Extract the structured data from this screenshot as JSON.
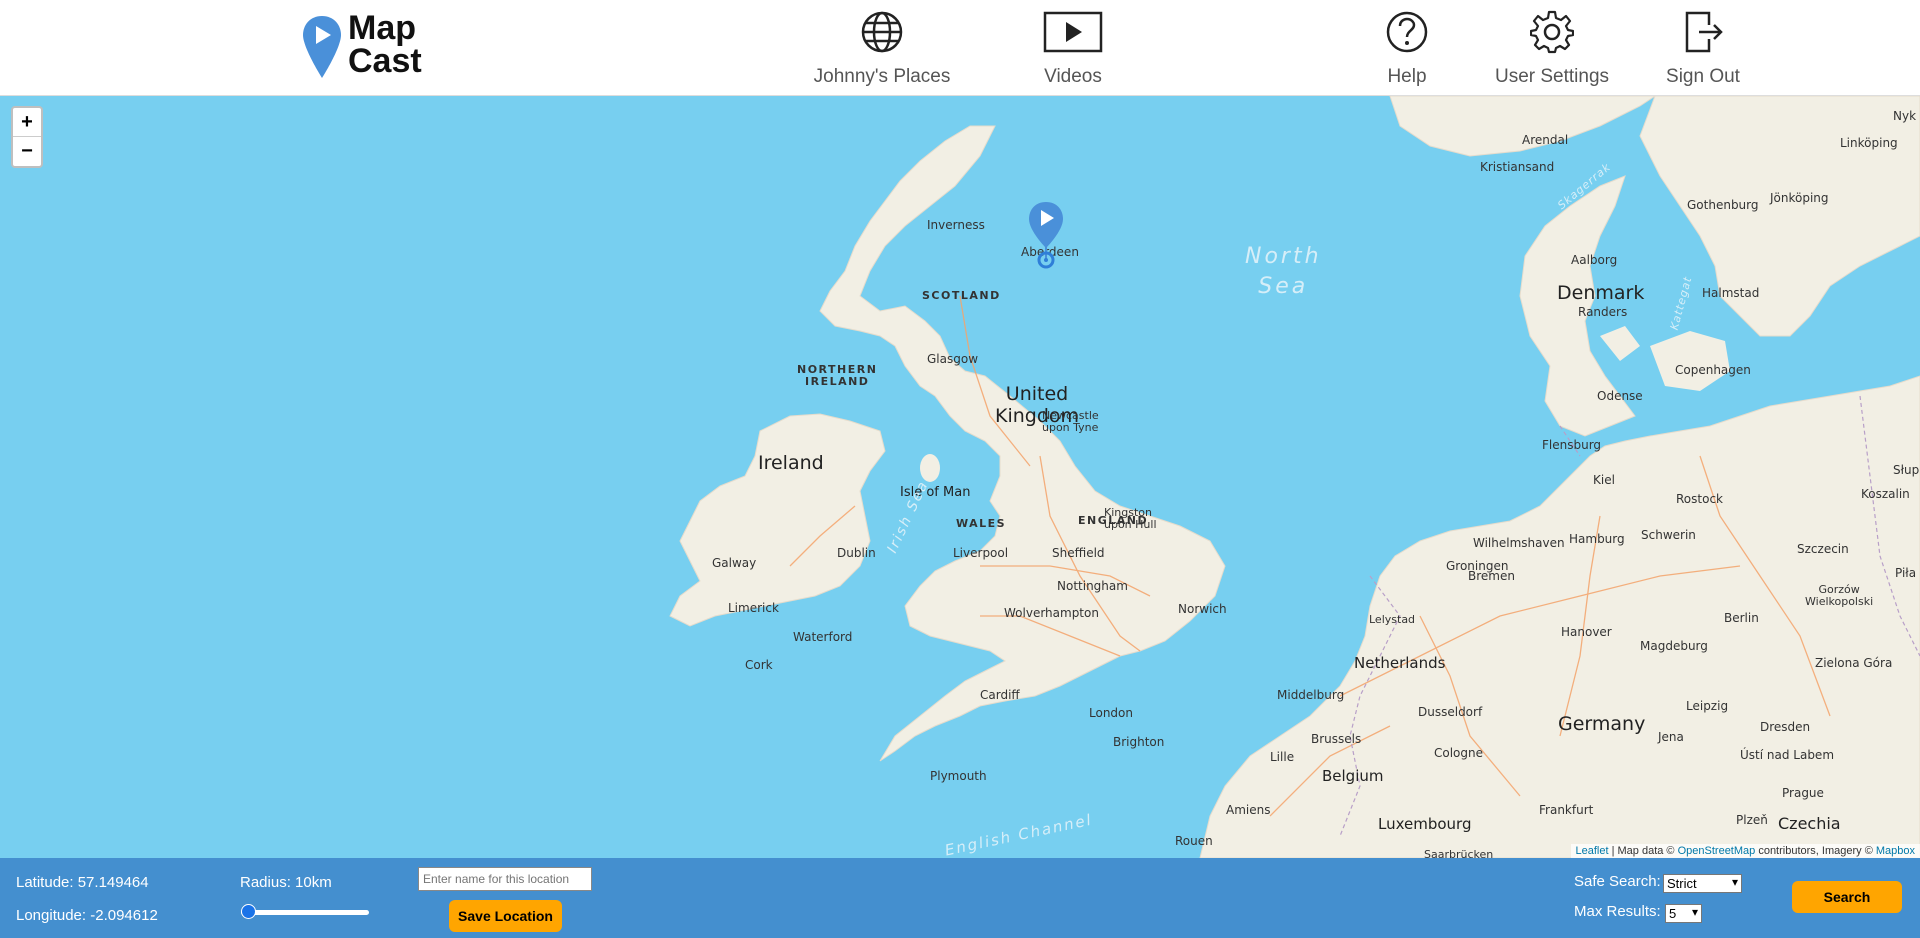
{
  "app": {
    "logo_line1": "Map",
    "logo_line2": "Cast"
  },
  "nav": [
    {
      "label": "Johnny's Places",
      "icon": "globe-icon"
    },
    {
      "label": "Videos",
      "icon": "play-video-icon"
    },
    {
      "label": "Help",
      "icon": "help-icon"
    },
    {
      "label": "User Settings",
      "icon": "gear-icon"
    },
    {
      "label": "Sign Out",
      "icon": "sign-out-icon"
    }
  ],
  "map": {
    "zoom_in": "+",
    "zoom_out": "−",
    "attribution": {
      "leaflet": "Leaflet",
      "text1": " | Map data © ",
      "osm": "OpenStreetMap",
      "text2": " contributors, Imagery © ",
      "mapbox": "Mapbox"
    },
    "labels": {
      "north_sea_1": "North",
      "north_sea_2": "Sea",
      "scotland": "SCOTLAND",
      "northern_ireland_1": "NORTHERN",
      "northern_ireland_2": "IRELAND",
      "uk_1": "United",
      "uk_2": "Kingdom",
      "ireland": "Ireland",
      "wales": "WALES",
      "england": "ENGLAND",
      "isle_of_man": "Isle of Man",
      "irish_sea": "Irish Sea",
      "english_channel": "English Channel",
      "denmark": "Denmark",
      "netherlands": "Netherlands",
      "belgium": "Belgium",
      "germany": "Germany",
      "luxembourg": "Luxembourg",
      "czechia": "Czechia",
      "skagerrak": "Skagerrak",
      "kattegat": "Kattegat",
      "inverness": "Inverness",
      "aberdeen": "Aberdeen",
      "glasgow": "Glasgow",
      "newcastle_1": "Newcastle",
      "newcastle_2": "upon Tyne",
      "kingston_1": "Kingston",
      "kingston_2": "upon Hull",
      "liverpool": "Liverpool",
      "sheffield": "Sheffield",
      "nottingham": "Nottingham",
      "wolverhampton": "Wolverhampton",
      "norwich": "Norwich",
      "london": "London",
      "cardiff": "Cardiff",
      "brighton": "Brighton",
      "plymouth": "Plymouth",
      "dublin": "Dublin",
      "galway": "Galway",
      "limerick": "Limerick",
      "waterford": "Waterford",
      "cork": "Cork",
      "rouen": "Rouen",
      "amiens": "Amiens",
      "lille": "Lille",
      "brussels": "Brussels",
      "middelburg": "Middelburg",
      "lelystad": "Lelystad",
      "groningen": "Groningen",
      "wilhelmshaven": "Wilhelmshaven",
      "bremen": "Bremen",
      "hamburg": "Hamburg",
      "schwerin": "Schwerin",
      "rostock": "Rostock",
      "kiel": "Kiel",
      "flensburg": "Flensburg",
      "odense": "Odense",
      "randers": "Randers",
      "aalborg": "Aalborg",
      "copenhagen": "Copenhagen",
      "halmstad": "Halmstad",
      "gothenburg": "Gothenburg",
      "jonkoping": "Jönköping",
      "linkoping": "Linköping",
      "kristiansand": "Kristiansand",
      "arendal": "Arendal",
      "hanover": "Hanover",
      "magdeburg": "Magdeburg",
      "berlin": "Berlin",
      "szczecin": "Szczecin",
      "koszalin": "Koszalin",
      "gorzow_1": "Gorzów",
      "gorzow_2": "Wielkopolski",
      "zielona_gora": "Zielona Góra",
      "leipzig": "Leipzig",
      "dresden": "Dresden",
      "jena": "Jena",
      "dusseldorf": "Dusseldorf",
      "cologne": "Cologne",
      "frankfurt": "Frankfurt",
      "saarbrucken": "Saarbrücken",
      "usti": "Ústí nad Labem",
      "prague": "Prague",
      "plzen": "Plzeň",
      "pila": "Piła",
      "stup": "Słup",
      "nyk": "Nyk"
    }
  },
  "bottom": {
    "latitude": "Latitude: 57.149464",
    "longitude": "Longitude: -2.094612",
    "radius": "Radius: 10km",
    "radius_level": 0.0,
    "location_placeholder": "Enter name for this location",
    "save_label": "Save Location",
    "safe_search_label": "Safe Search:",
    "safe_search_value": "Strict",
    "max_results_label": "Max Results:",
    "max_results_value": "5",
    "search_label": "Search"
  },
  "colors": {
    "bar": "#448fcf",
    "button": "#ffa500",
    "water": "#77cff0",
    "land": "#f2efe4",
    "pin": "#4a90d9"
  }
}
